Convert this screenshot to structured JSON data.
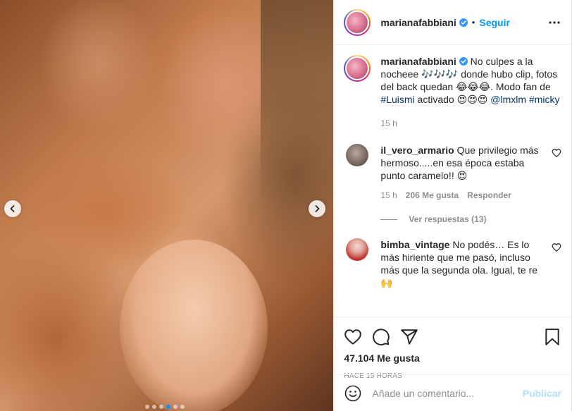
{
  "post": {
    "username": "marianafabbiani",
    "follow_label": "Seguir",
    "separator": "•"
  },
  "caption": {
    "username": "marianafabbiani",
    "text_part1": " No culpes a la nocheee 🎶🎶🎶 donde hubo clip, fotos del back quedan 😂😂😂. Modo fan de ",
    "hashtag1": "#Luismi",
    "text_part2": " activado 😍😍😍 ",
    "mention": "@lmxlm",
    "space": " ",
    "hashtag2": "#micky",
    "time": "15 h"
  },
  "comments": [
    {
      "username": "il_vero_armario",
      "text": " Que privilegio más hermoso.....en esa época estaba punto caramelo!! 😍",
      "time": "15 h",
      "likes": "206 Me gusta",
      "reply_label": "Responder",
      "view_replies": "Ver respuestas (13)"
    },
    {
      "username": "bimba_vintage",
      "text": " No podés… Es lo más hiriente que me pasó, incluso más que la segunda ola. Igual, te re 🙌"
    }
  ],
  "actions": {
    "likes_count": "47.104 Me gusta",
    "posted_ago": "HACE 15 HORAS"
  },
  "composer": {
    "placeholder": "Añade un comentario...",
    "publish_label": "Publicar"
  },
  "carousel": {
    "slide_count": 6,
    "active_index": 3
  },
  "colors": {
    "accent": "#0095f6",
    "publish_disabled": "#b2dffc",
    "muted": "#8e8e8e",
    "text": "#262626"
  },
  "icons": [
    "chevron-left-icon",
    "chevron-right-icon",
    "verified-badge-icon",
    "more-options-icon",
    "heart-icon",
    "comment-icon",
    "share-icon",
    "bookmark-icon",
    "emoji-icon"
  ]
}
